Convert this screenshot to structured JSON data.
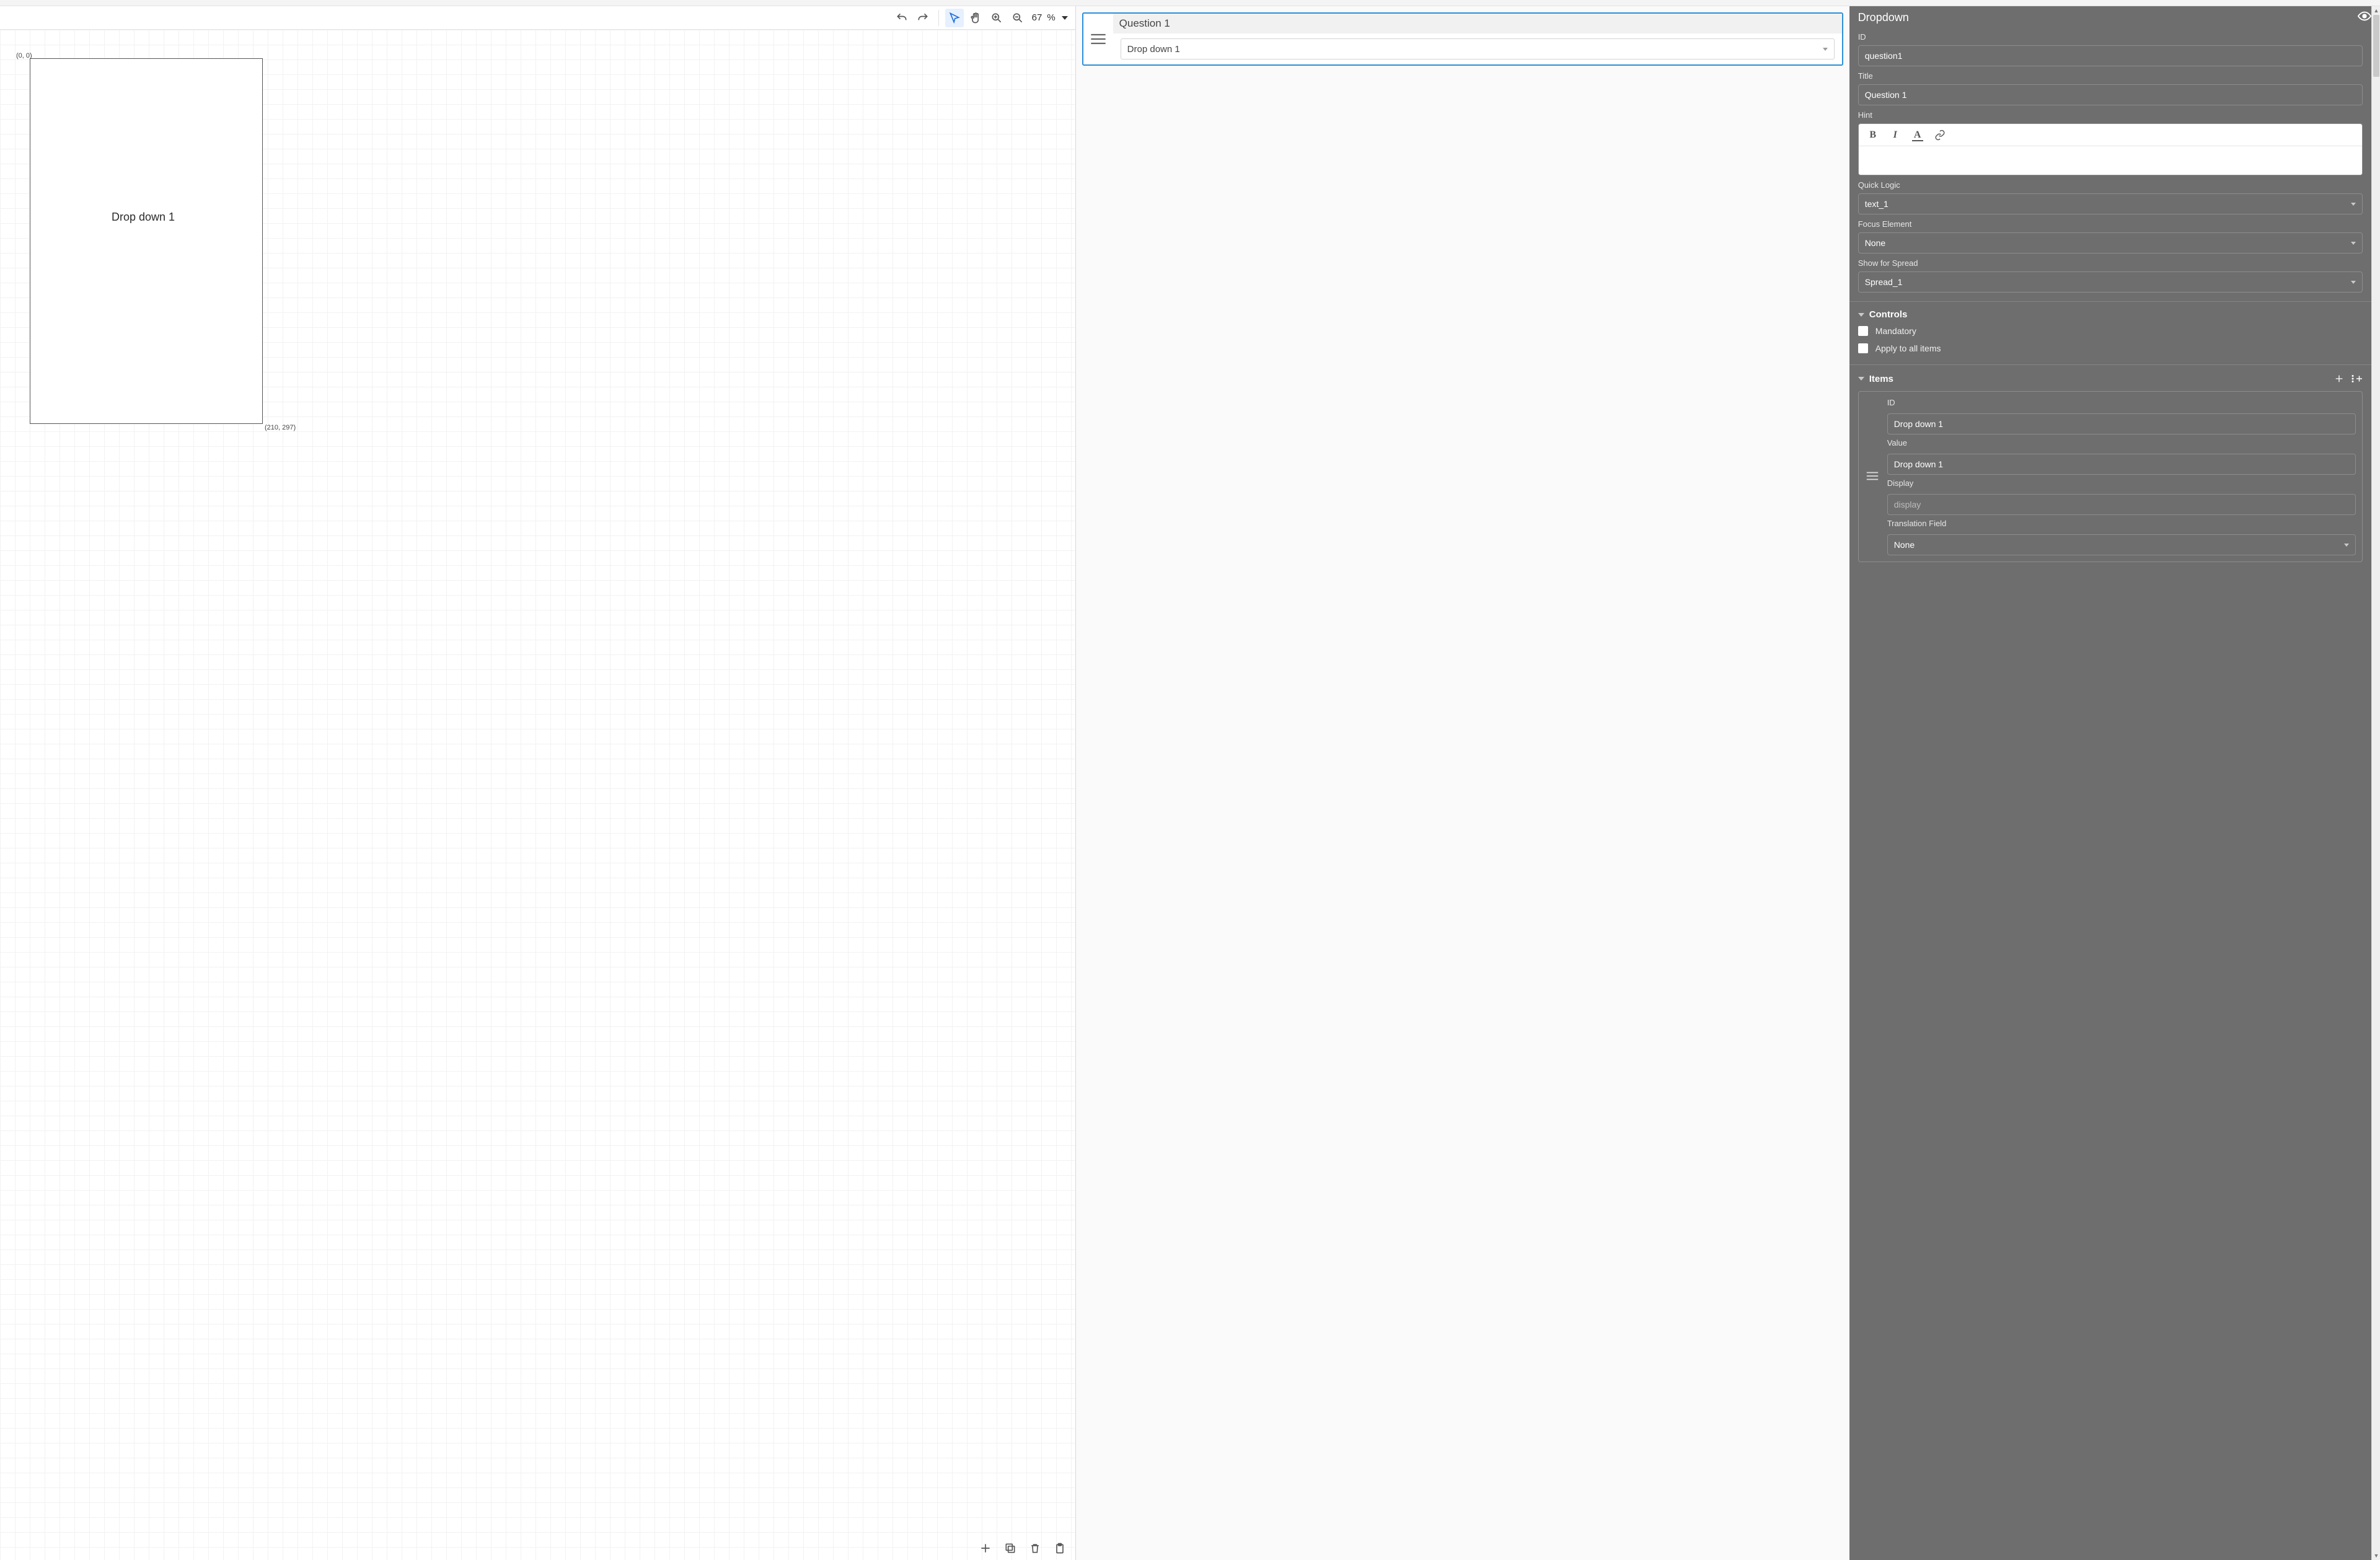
{
  "toolbar": {
    "zoom_value": "67",
    "zoom_unit": "%"
  },
  "canvas": {
    "coord_tl": "(0, 0)",
    "coord_br": "(210, 297)",
    "label": "Drop down 1"
  },
  "question_card": {
    "title": "Question 1",
    "selected": "Drop down 1"
  },
  "panel": {
    "header": "Dropdown",
    "id_label": "ID",
    "id_value": "question1",
    "title_label": "Title",
    "title_value": "Question 1",
    "hint_label": "Hint",
    "quick_logic_label": "Quick Logic",
    "quick_logic_value": "text_1",
    "focus_label": "Focus Element",
    "focus_value": "None",
    "spread_label": "Show for Spread",
    "spread_value": "Spread_1",
    "controls_header": "Controls",
    "mandatory_label": "Mandatory",
    "apply_all_label": "Apply to all items",
    "items_header": "Items",
    "item": {
      "id_label": "ID",
      "id_value": "Drop down 1",
      "value_label": "Value",
      "value_value": "Drop down 1",
      "display_label": "Display",
      "display_placeholder": "display",
      "translation_label": "Translation Field",
      "translation_value": "None"
    }
  }
}
